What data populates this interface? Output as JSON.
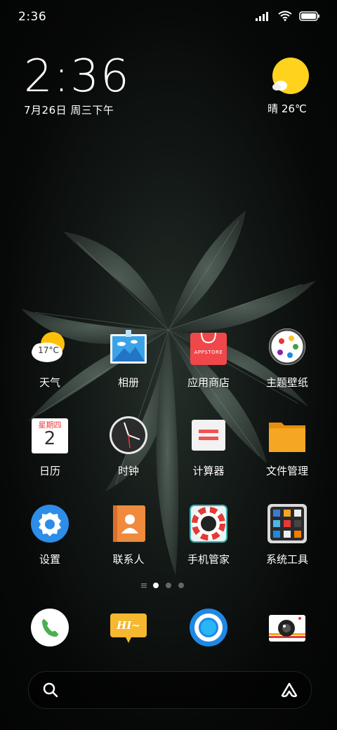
{
  "status_bar": {
    "time": "2:36",
    "icons": [
      "signal-icon",
      "wifi-icon",
      "battery-icon"
    ]
  },
  "clock_widget": {
    "time": "2:36",
    "date": "7月26日 周三下午"
  },
  "weather_widget": {
    "icon": "sunny-cloud-icon",
    "text": "晴 26℃"
  },
  "apps": [
    {
      "label": "天气",
      "icon": "weather-app-icon",
      "badge_text": "17°C"
    },
    {
      "label": "相册",
      "icon": "gallery-icon"
    },
    {
      "label": "应用商店",
      "icon": "app-store-icon",
      "badge_text": "APPSTORE"
    },
    {
      "label": "主题壁纸",
      "icon": "themes-icon"
    },
    {
      "label": "日历",
      "icon": "calendar-icon",
      "badge_text": "星期四",
      "day": "2"
    },
    {
      "label": "时钟",
      "icon": "clock-icon"
    },
    {
      "label": "计算器",
      "icon": "calculator-icon"
    },
    {
      "label": "文件管理",
      "icon": "file-manager-icon"
    },
    {
      "label": "设置",
      "icon": "settings-icon"
    },
    {
      "label": "联系人",
      "icon": "contacts-icon"
    },
    {
      "label": "手机管家",
      "icon": "security-icon"
    },
    {
      "label": "系统工具",
      "icon": "system-tools-folder-icon"
    }
  ],
  "page_indicator": {
    "pages": 3,
    "current": 1
  },
  "dock": [
    {
      "icon": "phone-icon"
    },
    {
      "icon": "messages-icon",
      "badge_text": "HI~"
    },
    {
      "icon": "browser-icon"
    },
    {
      "icon": "camera-icon"
    }
  ],
  "search_bar": {
    "left_icon": "search-icon",
    "right_icon": "assistant-icon"
  },
  "colors": {
    "weather_sun": "#FFD21E",
    "store_red": "#F0474A",
    "settings_blue": "#2D8DE8",
    "folder_orange": "#F5A623"
  }
}
